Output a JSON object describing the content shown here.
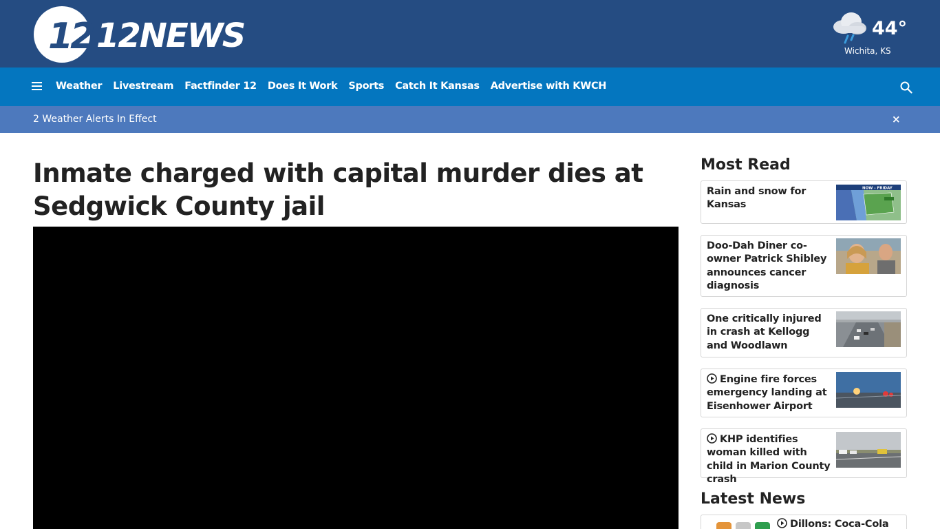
{
  "header": {
    "logo_text": "12NEWS",
    "weather": {
      "icon": "rain-cloud-icon",
      "temperature": "44°",
      "location": "Wichita, KS"
    },
    "colors": {
      "topbar": "#254c82",
      "navbar": "#0476bf",
      "alertbar": "#4d79bd"
    }
  },
  "nav": {
    "items": [
      "Weather",
      "Livestream",
      "Factfinder 12",
      "Does It Work",
      "Sports",
      "Catch It Kansas",
      "Advertise with KWCH"
    ]
  },
  "alert": {
    "text": "2 Weather Alerts In Effect",
    "close_label": "×"
  },
  "article": {
    "headline": "Inmate charged with capital murder dies at Sedgwick County jail"
  },
  "sidebar": {
    "most_read_title": "Most Read",
    "most_read": [
      {
        "title": "Rain and snow for Kansas",
        "has_video": false
      },
      {
        "title": "Doo-Dah Diner co-owner Patrick Shibley announces cancer diagnosis",
        "has_video": false
      },
      {
        "title": "One critically injured in crash at Kellogg and Woodlawn",
        "has_video": false
      },
      {
        "title": "Engine fire forces emergency landing at Eisenhower Airport",
        "has_video": true
      },
      {
        "title": "KHP identifies woman killed with child in Marion County crash",
        "has_video": true
      }
    ],
    "latest_news_title": "Latest News",
    "latest_news": [
      {
        "title": "Dillons: Coca-Cola",
        "has_video": true
      }
    ],
    "thumb_labels": {
      "weather_map": "NOW - FRIDAY"
    }
  }
}
